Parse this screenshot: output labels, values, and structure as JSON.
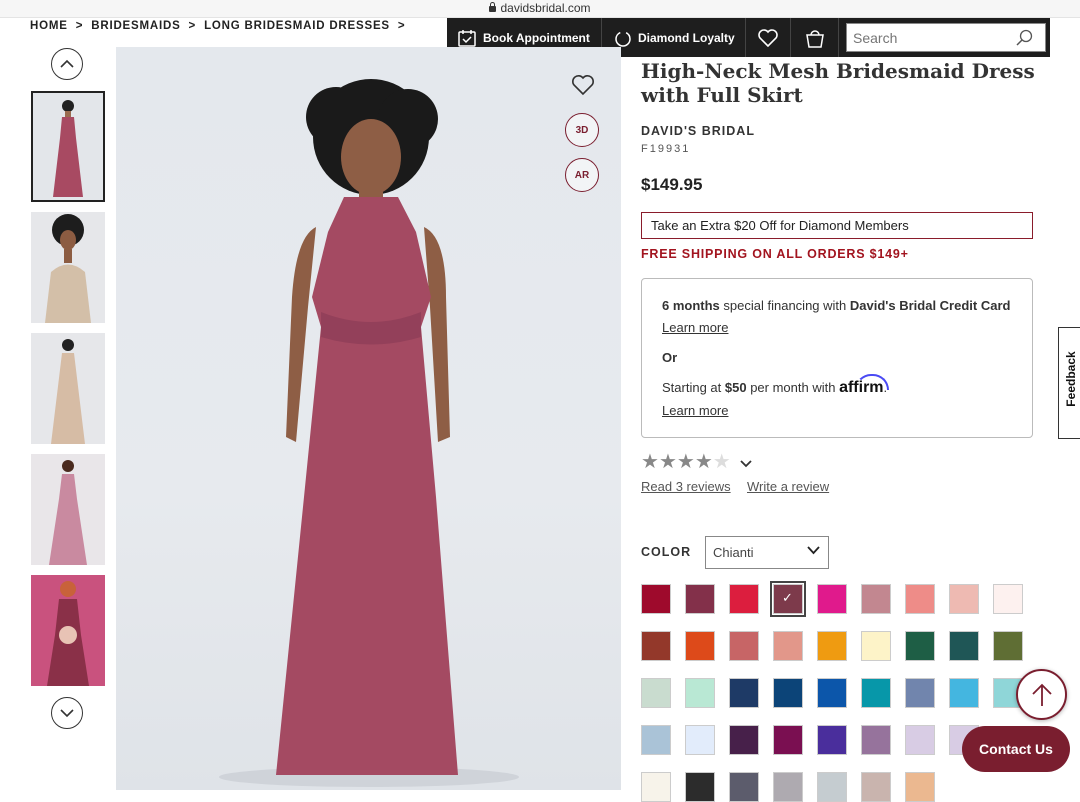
{
  "browser": {
    "url": "davidsbridal.com"
  },
  "breadcrumb": {
    "items": [
      "HOME",
      "BRIDESMAIDS",
      "LONG BRIDESMAID DRESSES"
    ],
    "separator": ">"
  },
  "topnav": {
    "book_label": "Book Appointment",
    "loyalty_label": "Diamond Loyalty",
    "search_placeholder": "Search"
  },
  "product": {
    "title": "High-Neck Mesh Bridesmaid Dress with Full Skirt",
    "brand": "DAVID'S BRIDAL",
    "sku": "F19931",
    "price": "$149.95",
    "promo": "Take an Extra $20 Off for Diamond Members",
    "shipping": "FREE SHIPPING ON ALL ORDERS $149+"
  },
  "financing": {
    "months": "6 months",
    "text": " special financing with ",
    "card": "David's Bridal Credit Card",
    "learn_more": "Learn more",
    "or": "Or",
    "starting": "Starting at ",
    "amount": "$50",
    "per_month": " per month with ",
    "affirm": "affirm",
    "learn_more2": "Learn more"
  },
  "reviews": {
    "rating": 4,
    "max": 5,
    "read_label": "Read 3 reviews",
    "write_label": "Write a review"
  },
  "color": {
    "label": "COLOR",
    "selected": "Chianti"
  },
  "swatch_colors": [
    [
      "#9e0a2c",
      "#83304a",
      "#dc1e3e",
      "#7d3a4b",
      "#e01a8c",
      "#c28790",
      "#ee8c88",
      "#eebab2",
      "#fdf1ef"
    ],
    [
      "#93382a",
      "#dd4a1a",
      "#c76566",
      "#e2978a",
      "#ef9b11",
      "#fdf3c8",
      "#1e5e45",
      "#1f5656",
      "#5f6e34"
    ],
    [
      "#c9dccf",
      "#b9e8d4",
      "#1e3a66",
      "#0c4478",
      "#0c56aa",
      "#0797a9",
      "#7185ad",
      "#44b6e0",
      "#8fd6d8"
    ],
    [
      "#aac3d7",
      "#e2ecfb",
      "#47204a",
      "#7a0f51",
      "#4a2e9c",
      "#96739c",
      "#d8cce4",
      "#d8cce4",
      null
    ],
    [
      "#f7f3ea",
      "#2c2c2c",
      "#5c5c6c",
      "#aeaab0",
      "#c5ccd0",
      "#c9b4ae",
      "#ebb890",
      null,
      null
    ]
  ],
  "selected_swatch": [
    0,
    3
  ],
  "thumbs": [
    "thumb-front",
    "thumb-closeup",
    "thumb-back",
    "thumb-model-pink",
    "thumb-bouquet"
  ],
  "feedback_label": "Feedback",
  "contact_label": "Contact Us"
}
